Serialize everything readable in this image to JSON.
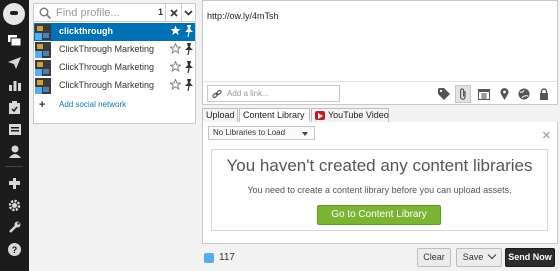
{
  "nav": {
    "items": [
      "home-icon",
      "compose-icon",
      "send-icon",
      "analytics-icon",
      "assignments-icon",
      "publisher-icon",
      "contacts-icon",
      "apps-icon",
      "settings-icon",
      "tools-icon",
      "help-icon"
    ]
  },
  "profiles": {
    "search_placeholder": "Find profile...",
    "selected_count": "1",
    "items": [
      {
        "name": "clickthrough",
        "selected": true
      },
      {
        "name": "ClickThrough Marketing",
        "selected": false
      },
      {
        "name": "ClickThrough Marketing",
        "selected": false
      },
      {
        "name": "ClickThrough Marketing",
        "selected": false
      }
    ],
    "add_network_label": "Add social network"
  },
  "composer": {
    "message_text": "http://ow.ly/4mTsh",
    "link_placeholder": "Add a link...",
    "tools": [
      "tag-icon",
      "attachment-icon",
      "schedule-icon",
      "location-icon",
      "targeting-icon",
      "privacy-icon"
    ]
  },
  "tabs": {
    "upload": "Upload",
    "content_library": "Content Library",
    "youtube": "YouTube Video"
  },
  "library": {
    "select_value": "No Libraries to Load",
    "heading": "You haven't created any content libraries",
    "message": "You need to create a content library before you can upload assets.",
    "button_label": "Go to Content Library"
  },
  "footer": {
    "char_count": "117",
    "clear_label": "Clear",
    "save_label": "Save",
    "send_label": "Send Now"
  },
  "colors": {
    "nav_bg": "#1c1c1c",
    "selected_blue": "#0071b6",
    "button_green": "#7ab432",
    "twitter_blue": "#55acee",
    "link_blue": "#0f77c2"
  }
}
